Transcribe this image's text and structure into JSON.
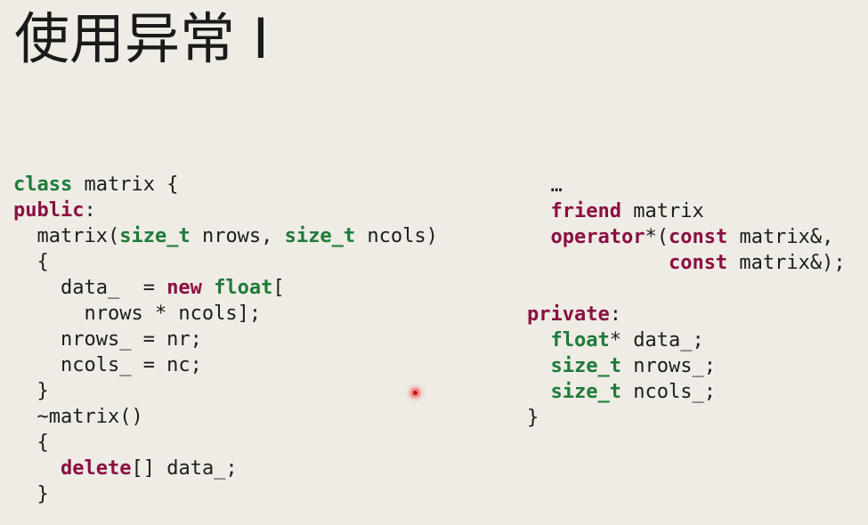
{
  "slide": {
    "title": "使用异常 I"
  },
  "code_left": [
    [
      {
        "t": "class",
        "k": "green"
      },
      {
        "t": " matrix {"
      }
    ],
    [
      {
        "t": "public",
        "k": "maroon"
      },
      {
        "t": ":"
      }
    ],
    [
      {
        "t": "  matrix("
      },
      {
        "t": "size_t",
        "k": "green"
      },
      {
        "t": " nrows, "
      },
      {
        "t": "size_t",
        "k": "green"
      },
      {
        "t": " ncols)"
      }
    ],
    [
      {
        "t": "  {"
      }
    ],
    [
      {
        "t": "    data_  = "
      },
      {
        "t": "new",
        "k": "maroon"
      },
      {
        "t": " "
      },
      {
        "t": "float",
        "k": "green"
      },
      {
        "t": "["
      }
    ],
    [
      {
        "t": "      nrows * ncols];"
      }
    ],
    [
      {
        "t": "    nrows_ = nr;"
      }
    ],
    [
      {
        "t": "    ncols_ = nc;"
      }
    ],
    [
      {
        "t": "  }"
      }
    ],
    [
      {
        "t": "  ~matrix()"
      }
    ],
    [
      {
        "t": "  {"
      }
    ],
    [
      {
        "t": "    "
      },
      {
        "t": "delete",
        "k": "maroon"
      },
      {
        "t": "[] data_;"
      }
    ],
    [
      {
        "t": "  }"
      }
    ]
  ],
  "code_right": [
    [
      {
        "t": "  …"
      }
    ],
    [
      {
        "t": "  "
      },
      {
        "t": "friend",
        "k": "maroon"
      },
      {
        "t": " matrix"
      }
    ],
    [
      {
        "t": "  "
      },
      {
        "t": "operator",
        "k": "maroon"
      },
      {
        "t": "*("
      },
      {
        "t": "const",
        "k": "maroon"
      },
      {
        "t": " matrix&,"
      }
    ],
    [
      {
        "t": "            "
      },
      {
        "t": "const",
        "k": "maroon"
      },
      {
        "t": " matrix&);"
      }
    ],
    [
      {
        "t": ""
      }
    ],
    [
      {
        "t": "private",
        "k": "maroon"
      },
      {
        "t": ":"
      }
    ],
    [
      {
        "t": "  "
      },
      {
        "t": "float",
        "k": "green"
      },
      {
        "t": "* data_;"
      }
    ],
    [
      {
        "t": "  "
      },
      {
        "t": "size_t",
        "k": "green"
      },
      {
        "t": " nrows_;"
      }
    ],
    [
      {
        "t": "  "
      },
      {
        "t": "size_t",
        "k": "green"
      },
      {
        "t": " ncols_;"
      }
    ],
    [
      {
        "t": "}"
      }
    ]
  ],
  "colors": {
    "background": "#eeece4",
    "keyword_green": "#1e7a3a",
    "keyword_maroon": "#8a0f42",
    "text": "#1c1c1c"
  }
}
